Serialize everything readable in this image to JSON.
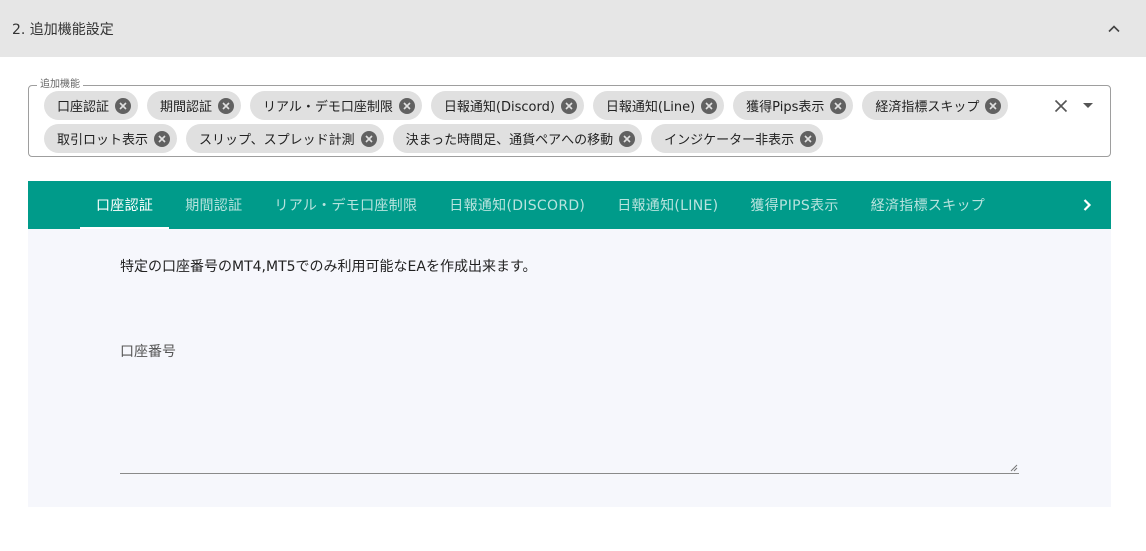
{
  "section": {
    "title": "2. 追加機能設定"
  },
  "features_select": {
    "label": "追加機能",
    "chips": [
      {
        "label": "口座認証"
      },
      {
        "label": "期間認証"
      },
      {
        "label": "リアル・デモ口座制限"
      },
      {
        "label": "日報通知(Discord)"
      },
      {
        "label": "日報通知(Line)"
      },
      {
        "label": "獲得Pips表示"
      },
      {
        "label": "経済指標スキップ"
      },
      {
        "label": "取引ロット表示"
      },
      {
        "label": "スリップ、スプレッド計測"
      },
      {
        "label": "決まった時間足、通貨ペアへの移動"
      },
      {
        "label": "インジケーター非表示"
      }
    ]
  },
  "tabs": {
    "items": [
      {
        "label": "口座認証",
        "active": true
      },
      {
        "label": "期間認証",
        "active": false
      },
      {
        "label": "リアル・デモ口座制限",
        "active": false
      },
      {
        "label": "日報通知(DISCORD)",
        "active": false
      },
      {
        "label": "日報通知(LINE)",
        "active": false
      },
      {
        "label": "獲得PIPS表示",
        "active": false
      },
      {
        "label": "経済指標スキップ",
        "active": false
      }
    ],
    "accent_color": "#009b8a"
  },
  "panel": {
    "description": "特定の口座番号のMT4,MT5でのみ利用可能なEAを作成出来ます。",
    "field_label": "口座番号",
    "field_value": ""
  }
}
